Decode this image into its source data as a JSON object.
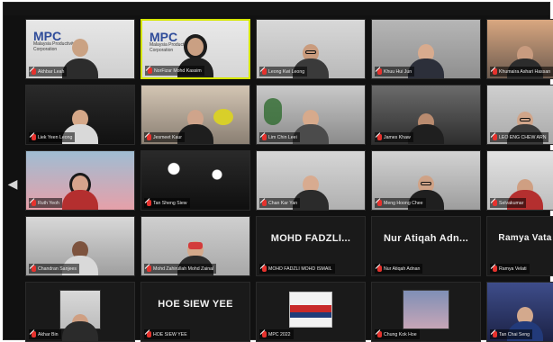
{
  "ui": {
    "speaking_border_color": "#d5e600",
    "mic_muted_color": "#e5322d",
    "left_nav_icon": "chevron-left-icon"
  },
  "participants": [
    {
      "label": "Akhbar Leah",
      "speaking": false,
      "type": "video",
      "scene": "mpc-backdrop"
    },
    {
      "label": "NorFizar Mohd Kassim",
      "speaking": true,
      "type": "video",
      "scene": "mpc-backdrop-hijab"
    },
    {
      "label": "Leong Kwi Leong",
      "speaking": false,
      "type": "video",
      "scene": "home-man-glasses"
    },
    {
      "label": "Khuu Hui Jun",
      "speaking": false,
      "type": "video",
      "scene": "home-woman"
    },
    {
      "label": "Khumaira Ashari Hassan",
      "speaking": false,
      "type": "video",
      "scene": "office-man"
    },
    {
      "label": "Liek Yeen Leong",
      "speaking": false,
      "type": "video",
      "scene": "woman"
    },
    {
      "label": "Jesmeet Kaur",
      "speaking": false,
      "type": "video",
      "scene": "woman-headset"
    },
    {
      "label": "Lim Chin Leei",
      "speaking": false,
      "type": "video",
      "scene": "woman-plants"
    },
    {
      "label": "James Khaw",
      "speaking": false,
      "type": "video",
      "scene": "man-dark-room"
    },
    {
      "label": "LEO ENG CHEW ARN",
      "speaking": false,
      "type": "video",
      "scene": "woman-glasses"
    },
    {
      "label": "Ruth Yeoh",
      "speaking": false,
      "type": "video",
      "scene": "woman-headphones"
    },
    {
      "label": "Tan Sheng Siew",
      "speaking": false,
      "type": "video",
      "scene": "ceiling-lights"
    },
    {
      "label": "Chan Kar Yan",
      "speaking": false,
      "type": "video",
      "scene": "woman-smiling"
    },
    {
      "label": "Meng Hoong Chee",
      "speaking": false,
      "type": "video",
      "scene": "man-glasses"
    },
    {
      "label": "Selvakumar",
      "speaking": false,
      "type": "video",
      "scene": "man-red"
    },
    {
      "label": "Chandran Sanjees",
      "speaking": false,
      "type": "video",
      "scene": "man"
    },
    {
      "label": "Mohd Zahirullah Mohd Zainal",
      "speaking": false,
      "type": "video",
      "scene": "woman-mask"
    },
    {
      "label": "MOHD FADZLI MOHD ISMAIL",
      "speaking": false,
      "type": "name",
      "display_name": "MOHD FADZLI..."
    },
    {
      "label": "Nur Atiqah Adnan",
      "speaking": false,
      "type": "name",
      "display_name": "Nur Atiqah Adn..."
    },
    {
      "label": "Ramya Velati",
      "speaking": false,
      "type": "name",
      "display_name": "Ramya Vata"
    },
    {
      "label": "Akhar Bin",
      "speaking": false,
      "type": "video",
      "scene": "man-portrait"
    },
    {
      "label": "HOE SIEW YEE",
      "speaking": false,
      "type": "name",
      "display_name": "HOE SIEW YEE"
    },
    {
      "label": "MPC 2022",
      "speaking": false,
      "type": "video",
      "scene": "poster"
    },
    {
      "label": "Chung Kok Hoe",
      "speaking": false,
      "type": "video",
      "scene": "city-image"
    },
    {
      "label": "Tan Chai Seng",
      "speaking": false,
      "type": "video",
      "scene": "man-suit"
    }
  ]
}
